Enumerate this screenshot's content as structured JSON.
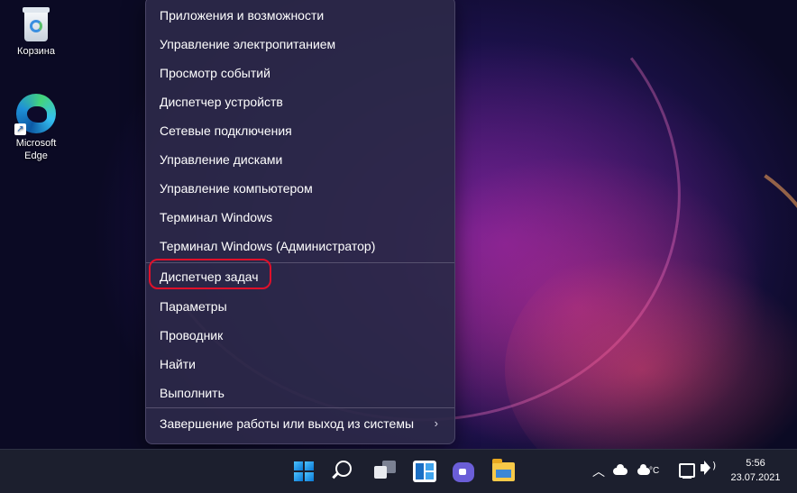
{
  "desktop": {
    "icons": [
      {
        "label": "Корзина",
        "icon": "recycle-bin-icon"
      },
      {
        "label": "Microsoft\nEdge",
        "label_line1": "Microsoft",
        "label_line2": "Edge",
        "icon": "edge-icon"
      }
    ]
  },
  "menu": {
    "items": [
      {
        "label": "Приложения и возможности"
      },
      {
        "label": "Управление электропитанием"
      },
      {
        "label": "Просмотр событий"
      },
      {
        "label": "Диспетчер устройств"
      },
      {
        "label": "Сетевые подключения"
      },
      {
        "label": "Управление дисками"
      },
      {
        "label": "Управление компьютером"
      },
      {
        "label": "Терминал Windows"
      },
      {
        "label": "Терминал Windows (Администратор)"
      },
      {
        "label": "Диспетчер задач",
        "highlighted": true
      },
      {
        "label": "Параметры"
      },
      {
        "label": "Проводник"
      },
      {
        "label": "Найти"
      },
      {
        "label": "Выполнить"
      },
      {
        "label": "Завершение работы или выход из системы",
        "submenu": true
      }
    ],
    "highlight_color": "#e0102a"
  },
  "taskbar": {
    "apps": [
      "windows-start-icon",
      "search-icon",
      "task-view-icon",
      "widgets-icon",
      "teams-chat-icon",
      "file-explorer-icon"
    ],
    "tray": {
      "weather_label": "°C",
      "time": "5:56",
      "date": "23.07.2021"
    }
  }
}
